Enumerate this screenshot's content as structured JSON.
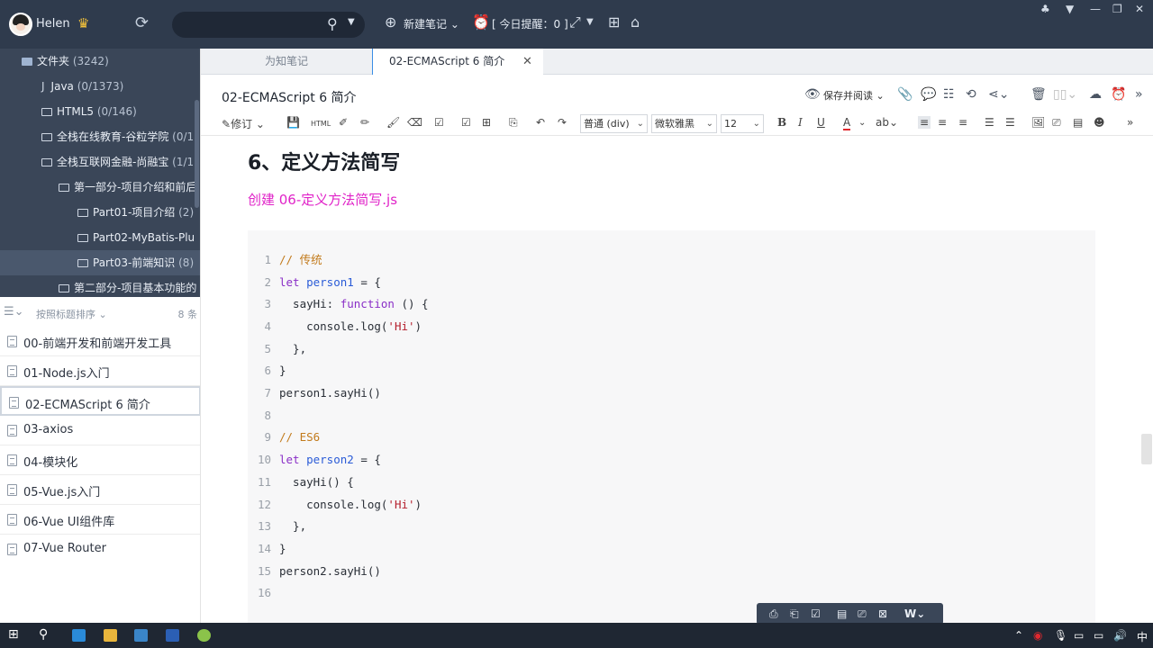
{
  "user": {
    "name": "Helen"
  },
  "search": {
    "placeholder": ""
  },
  "topbar": {
    "new_note": "新建笔记",
    "reminder": "[ 今日提醒：0 ]"
  },
  "tree": {
    "items": [
      {
        "label": "文件夹",
        "count": "(3242)"
      },
      {
        "label": "Java",
        "count": "(0/1373)"
      },
      {
        "label": "HTML5",
        "count": "(0/146)"
      },
      {
        "label": "全栈在线教育-谷粒学院",
        "count": "(0/1"
      },
      {
        "label": "全栈互联网金融-尚融宝",
        "count": "(1/1"
      },
      {
        "label": "第一部分-项目介绍和前后",
        "count": ""
      },
      {
        "label": "Part01-项目介绍",
        "count": "(2)"
      },
      {
        "label": "Part02-MyBatis-Plu",
        "count": ""
      },
      {
        "label": "Part03-前端知识",
        "count": "(8)"
      },
      {
        "label": "第二部分-项目基本功能的",
        "count": ""
      }
    ]
  },
  "list": {
    "sort_label": "按照标题排序",
    "count": "8 条",
    "items": [
      "00-前端开发和前端开发工具",
      "01-Node.js入门",
      "02-ECMAScript 6 简介",
      "03-axios",
      "04-模块化",
      "05-Vue.js入门",
      "06-Vue UI组件库",
      "07-Vue Router"
    ]
  },
  "tabs": {
    "inactive": "为知笔记",
    "active": "02-ECMAScript 6 简介"
  },
  "editor": {
    "title": "02-ECMAScript 6 简介",
    "save_read": "保存并阅读",
    "revise": "修订",
    "html": "HTML",
    "paragraph": "普通 (div)",
    "font": "微软雅黑",
    "size": "12"
  },
  "doc": {
    "heading": "6、定义方法简写",
    "subtitle": "创建 06-定义方法简写.js",
    "code_lines": [
      {
        "n": "1",
        "text": "// 传统"
      },
      {
        "n": "2",
        "text": "let person1 = {"
      },
      {
        "n": "3",
        "text": "  sayHi: function () {"
      },
      {
        "n": "4",
        "text": "    console.log('Hi')"
      },
      {
        "n": "5",
        "text": "  },"
      },
      {
        "n": "6",
        "text": "}"
      },
      {
        "n": "7",
        "text": "person1.sayHi()"
      },
      {
        "n": "8",
        "text": ""
      },
      {
        "n": "9",
        "text": "// ES6"
      },
      {
        "n": "10",
        "text": "let person2 = {"
      },
      {
        "n": "11",
        "text": "  sayHi() {"
      },
      {
        "n": "12",
        "text": "    console.log('Hi')"
      },
      {
        "n": "13",
        "text": "  },"
      },
      {
        "n": "14",
        "text": "}"
      },
      {
        "n": "15",
        "text": "person2.sayHi()"
      },
      {
        "n": "16",
        "text": ""
      }
    ]
  },
  "taskbar": {
    "ime": "中"
  },
  "colors": {
    "sidebar_bg": "#3a4658",
    "topbar_bg": "#2f3b4d",
    "subtitle": "#e023c8",
    "accent": "#3a8ee6"
  }
}
